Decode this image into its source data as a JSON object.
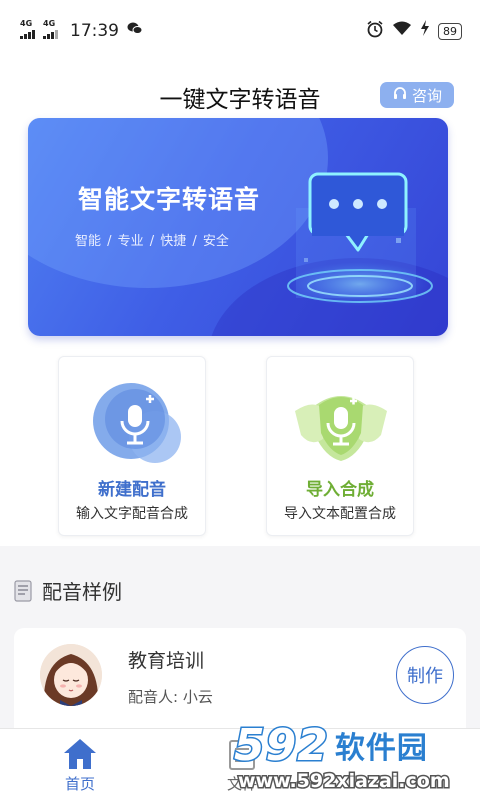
{
  "status_bar": {
    "network_1": "4G",
    "network_2": "4G",
    "time": "17:39",
    "battery": "89"
  },
  "header": {
    "title": "一键文字转语音",
    "consult_label": "咨询"
  },
  "banner": {
    "title": "智能文字转语音",
    "tags": "智能 / 专业 / 快捷 / 安全"
  },
  "features": [
    {
      "title": "新建配音",
      "subtitle": "输入文字配音合成",
      "color": "#3f6fcc"
    },
    {
      "title": "导入合成",
      "subtitle": "导入文本配置合成",
      "color": "#6fae35"
    }
  ],
  "samples": {
    "section_title": "配音样例",
    "items": [
      {
        "name": "教育培训",
        "voice": "配音人: 小云",
        "action": "制作"
      }
    ]
  },
  "bottom_nav": [
    {
      "label": "首页",
      "icon": "home-icon",
      "active": true
    },
    {
      "label": "文件",
      "icon": "file-icon",
      "active": false
    }
  ],
  "watermark": {
    "number": "592",
    "brand": "软件园",
    "url": "www.592xiazai.com"
  },
  "colors": {
    "accent_blue": "#3f6fcc",
    "accent_green": "#6fae35",
    "banner_blue": "#3f5ee6",
    "consult_bg": "#8db0ef"
  }
}
